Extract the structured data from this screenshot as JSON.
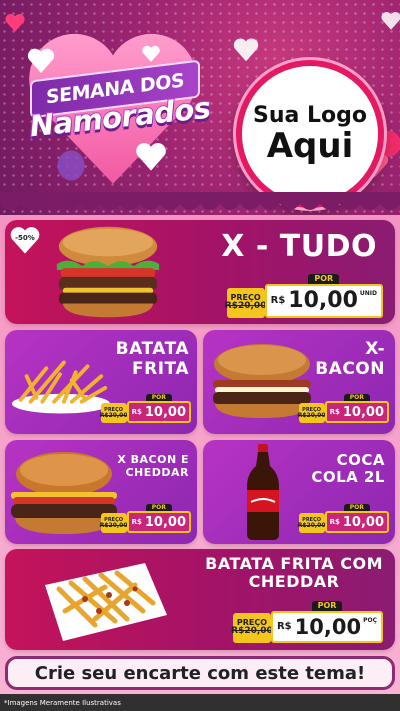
{
  "header": {
    "title_top": "SEMANA DOS",
    "title_main": "Namorados",
    "logo_line1": "Sua Logo",
    "logo_line2": "Aqui"
  },
  "discount_badge": "-50%",
  "products": [
    {
      "name_lines": [
        "X - TUDO"
      ],
      "old_label": "PREÇO",
      "old_price": "R$20,00",
      "por_label": "POR",
      "currency": "R$",
      "new_price": "10,00",
      "unit": "UNID"
    },
    {
      "name_lines": [
        "BATATA",
        "FRITA"
      ],
      "old_label": "PREÇO",
      "old_price": "R$20,00",
      "por_label": "POR",
      "currency": "R$",
      "new_price": "10,00"
    },
    {
      "name_lines": [
        "X-",
        "BACON"
      ],
      "old_label": "PREÇO",
      "old_price": "R$20,00",
      "por_label": "POR",
      "currency": "R$",
      "new_price": "10,00"
    },
    {
      "name_lines": [
        "X BACON E",
        "CHEDDAR"
      ],
      "old_label": "PREÇO",
      "old_price": "R$20,00",
      "por_label": "POR",
      "currency": "R$",
      "new_price": "10,00"
    },
    {
      "name_lines": [
        "COCA",
        "COLA 2L"
      ],
      "old_label": "PREÇO",
      "old_price": "R$20,00",
      "por_label": "POR",
      "currency": "R$",
      "new_price": "10,00"
    },
    {
      "name_lines": [
        "BATATA FRITA COM",
        "CHEDDAR"
      ],
      "old_label": "PREÇO",
      "old_price": "R$20,00",
      "por_label": "POR",
      "currency": "R$",
      "new_price": "10,00",
      "unit": "POÇ"
    }
  ],
  "cta": "Crie seu encarte com este tema!",
  "footer_note": "*Imagens Meramente Ilustrativas",
  "colors": {
    "accent_pink": "#c4135a",
    "purple": "#8d28b0",
    "price_yellow": "#f4c51d"
  }
}
